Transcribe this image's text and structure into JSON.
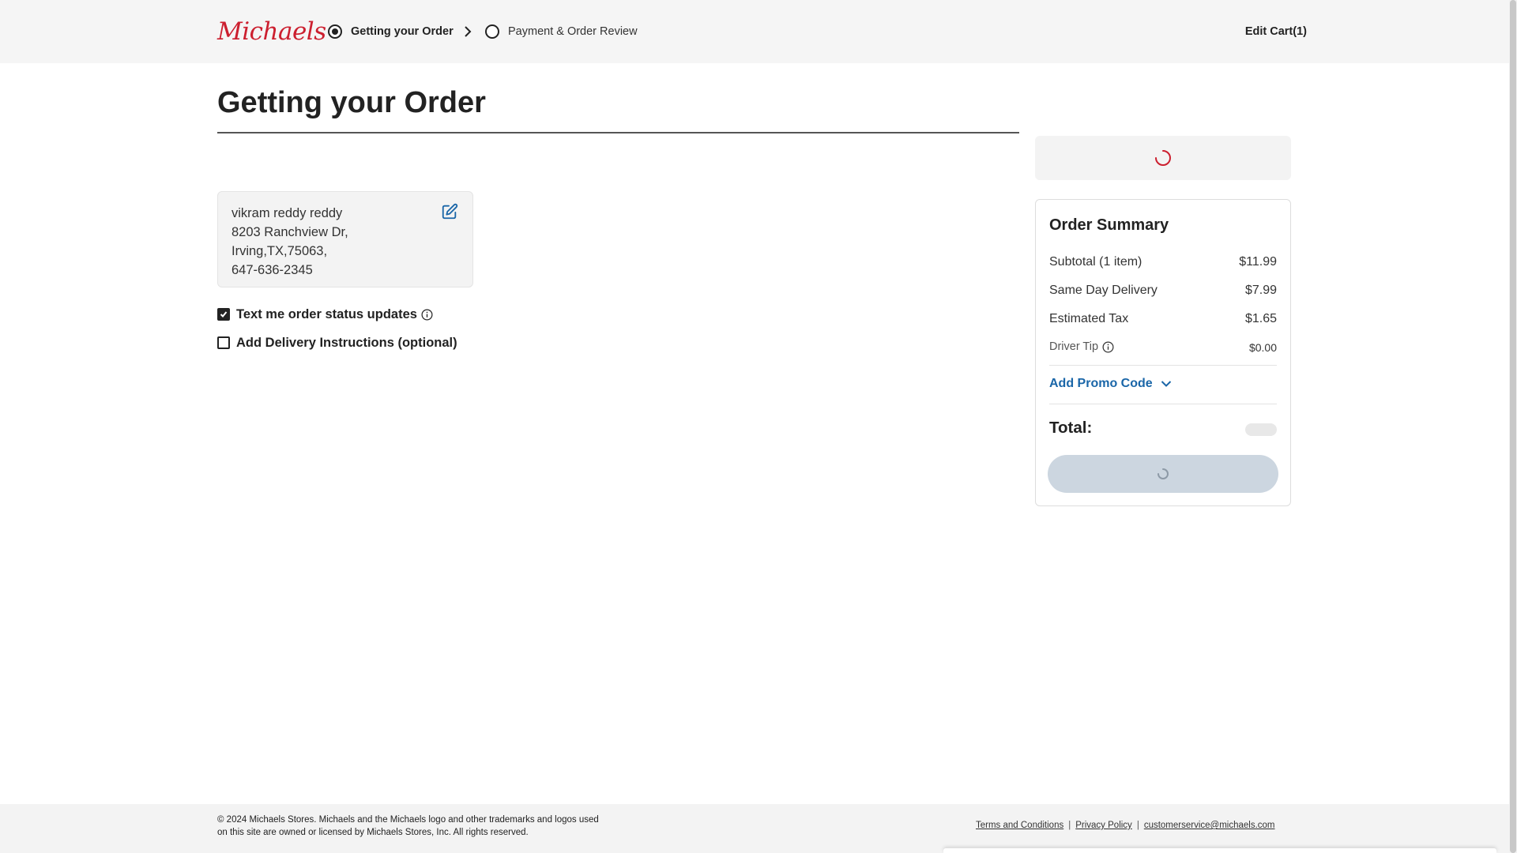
{
  "header": {
    "logo_text": "Michaels",
    "steps": [
      {
        "label": "Getting your Order",
        "active": true
      },
      {
        "label": "Payment & Order Review",
        "active": false
      }
    ],
    "edit_cart_label": "Edit Cart(1)"
  },
  "main": {
    "title": "Getting your Order",
    "address": {
      "name": "vikram reddy reddy",
      "street": "8203 Ranchview Dr,",
      "city_line": "Irving,TX,75063,",
      "phone": "647-636-2345"
    },
    "options": [
      {
        "label": "Text me order status updates",
        "checked": true
      },
      {
        "label": "Add Delivery Instructions (optional)",
        "checked": false
      }
    ]
  },
  "summary": {
    "title": "Order Summary",
    "lines": [
      {
        "label": "Subtotal (1 item)",
        "value": "$11.99"
      },
      {
        "label": "Same Day Delivery",
        "value": "$7.99"
      },
      {
        "label": "Estimated Tax",
        "value": "$1.65"
      },
      {
        "label": "Driver Tip",
        "value": "$0.00"
      }
    ],
    "promo_label": "Add Promo Code",
    "total_label": "Total:"
  },
  "footer": {
    "legal": "© 2024 Michaels Stores. Michaels and the Michaels logo and other trademarks and logos used on this site are owned or licensed by Michaels Stores, Inc. All rights reserved.",
    "links": [
      "Terms and Conditions",
      "Privacy Policy",
      "customerservice@michaels.com"
    ],
    "separator": "|"
  },
  "colors": {
    "brand_red": "#cc1f2f",
    "link_blue": "#1a66a8",
    "header_bg": "#f5f5f5",
    "button_disabled": "#ccd6e0"
  }
}
